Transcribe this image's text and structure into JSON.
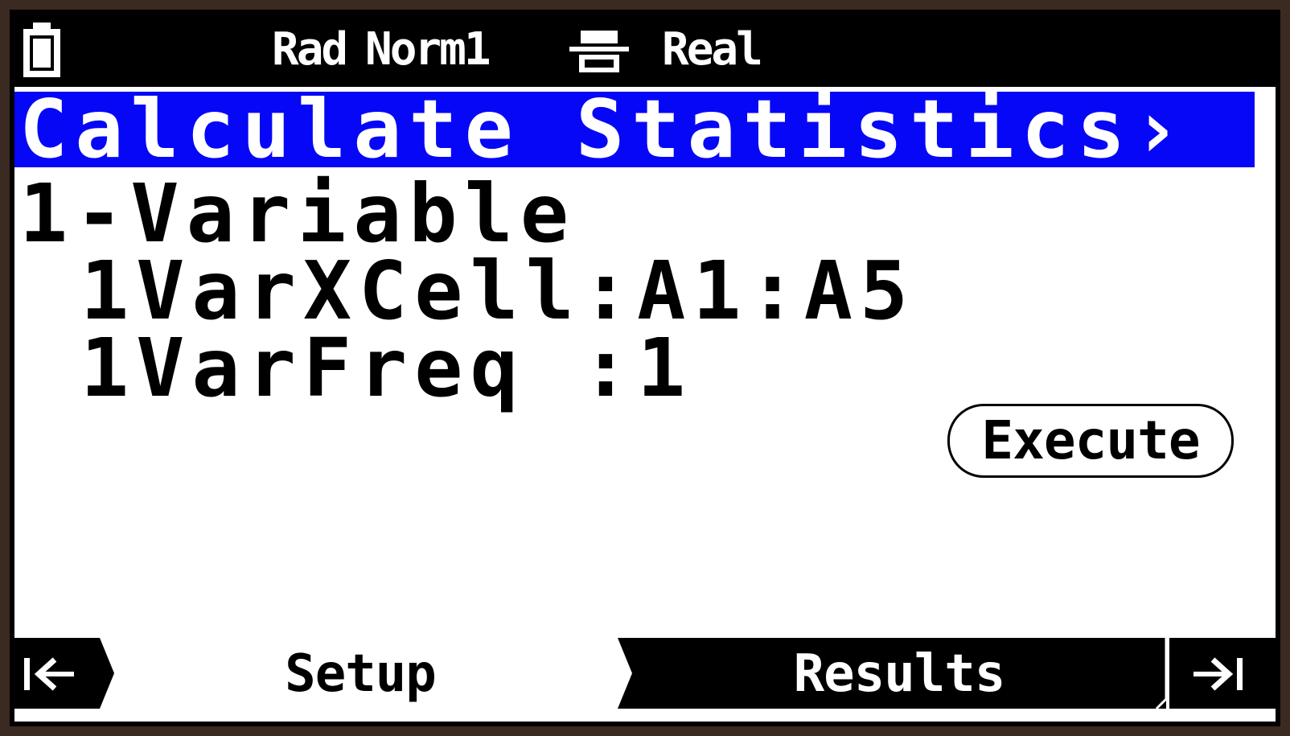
{
  "status_bar": {
    "battery_icon": "battery-icon",
    "angle_mode": "Rad",
    "display_mode": "Norm1",
    "format_icon": "fraction-format-icon",
    "complex_mode": "Real"
  },
  "title": "Calculate Statistics›",
  "content": {
    "heading": "1-Variable",
    "rows": [
      {
        "label": "1VarXCell",
        "separator": ":",
        "value": "A1:A5"
      },
      {
        "label": "1VarFreq ",
        "separator": ":",
        "value": "1"
      }
    ],
    "execute_label": "Execute"
  },
  "softkeys": {
    "first_icon": "jump-first-icon",
    "tabs": [
      {
        "label": "Setup",
        "active": false
      },
      {
        "label": "Results",
        "active": true
      }
    ],
    "last_icon": "jump-last-icon"
  },
  "colors": {
    "title_bar": "#0707f7",
    "background": "#ffffff",
    "foreground": "#000000"
  }
}
